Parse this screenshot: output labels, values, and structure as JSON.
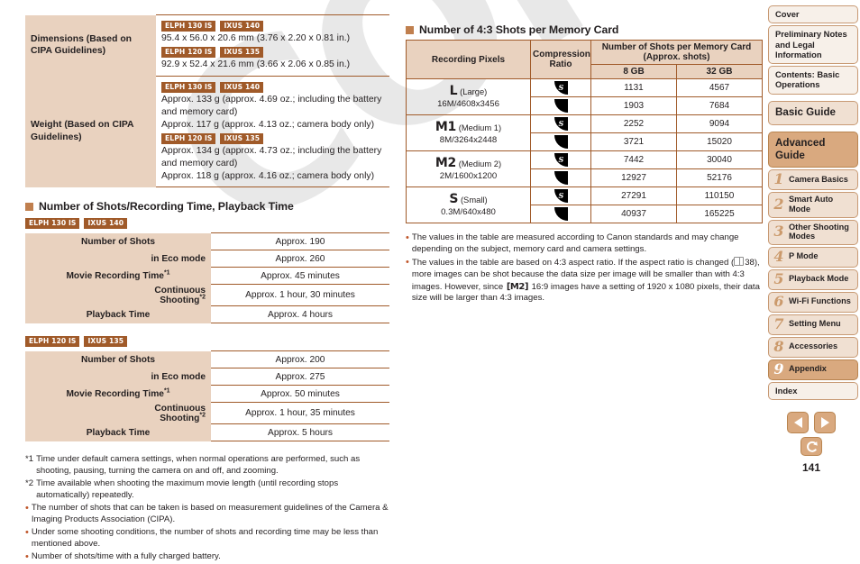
{
  "page": {
    "number": "141"
  },
  "badges": {
    "elph130": "ELPH 130 IS",
    "ixus140": "IXUS 140",
    "elph120": "ELPH 120 IS",
    "ixus135": "IXUS 135"
  },
  "spec_table": {
    "rows": [
      {
        "label": "Dimensions (Based on CIPA Guidelines)",
        "groups": [
          {
            "badges": [
              "ELPH 130 IS",
              "IXUS 140"
            ],
            "lines": [
              "95.4 x 56.0 x 20.6 mm (3.76 x 2.20 x 0.81 in.)"
            ]
          },
          {
            "badges": [
              "ELPH 120 IS",
              "IXUS 135"
            ],
            "lines": [
              "92.9 x 52.4 x 21.6 mm (3.66 x 2.06 x 0.85 in.)"
            ]
          }
        ]
      },
      {
        "label": "Weight (Based on CIPA Guidelines)",
        "groups": [
          {
            "badges": [
              "ELPH 130 IS",
              "IXUS 140"
            ],
            "lines": [
              "Approx. 133 g (approx. 4.69 oz.; including the battery and memory card)",
              "Approx. 117 g (approx. 4.13 oz.; camera body only)"
            ]
          },
          {
            "badges": [
              "ELPH 120 IS",
              "IXUS 135"
            ],
            "lines": [
              "Approx. 134 g (approx. 4.73 oz.; including the battery and memory card)",
              "Approx. 118 g (approx. 4.16 oz.; camera body only)"
            ]
          }
        ]
      }
    ]
  },
  "shots_section": {
    "marker": "square-marker",
    "heading": "Number of Shots/Recording Time, Playback Time",
    "tables": [
      {
        "badges": [
          "ELPH 130 IS",
          "IXUS 140"
        ],
        "rows": [
          {
            "label": "Number of Shots",
            "indent": false,
            "footnote": "",
            "value": "Approx. 190"
          },
          {
            "label": "in Eco mode",
            "indent": true,
            "footnote": "",
            "value": "Approx. 260"
          },
          {
            "label": "Movie Recording Time",
            "indent": false,
            "footnote": "*1",
            "value": "Approx. 45 minutes"
          },
          {
            "label": "Continuous Shooting",
            "indent": true,
            "footnote": "*2",
            "value": "Approx. 1 hour, 30 minutes"
          },
          {
            "label": "Playback Time",
            "indent": false,
            "footnote": "",
            "value": "Approx. 4 hours"
          }
        ]
      },
      {
        "badges": [
          "ELPH 120 IS",
          "IXUS 135"
        ],
        "rows": [
          {
            "label": "Number of Shots",
            "indent": false,
            "footnote": "",
            "value": "Approx. 200"
          },
          {
            "label": "in Eco mode",
            "indent": true,
            "footnote": "",
            "value": "Approx. 275"
          },
          {
            "label": "Movie Recording Time",
            "indent": false,
            "footnote": "*1",
            "value": "Approx. 50 minutes"
          },
          {
            "label": "Continuous Shooting",
            "indent": true,
            "footnote": "*2",
            "value": "Approx. 1 hour, 35 minutes"
          },
          {
            "label": "Playback Time",
            "indent": false,
            "footnote": "",
            "value": "Approx. 5 hours"
          }
        ]
      }
    ]
  },
  "left_notes": [
    {
      "mark": "*1",
      "text": "Time under default camera settings, when normal operations are performed, such as shooting, pausing, turning the camera on and off, and zooming."
    },
    {
      "mark": "*2",
      "text": "Time available when shooting the maximum movie length (until recording stops automatically) repeatedly."
    },
    {
      "mark": "•",
      "text": "The number of shots that can be taken is based on measurement guidelines of the Camera & Imaging Products Association (CIPA)."
    },
    {
      "mark": "•",
      "text": "Under some shooting conditions, the number of shots and recording time may be less than mentioned above."
    },
    {
      "mark": "•",
      "text": "Number of shots/time with a fully charged battery."
    }
  ],
  "memory_section": {
    "heading": "Number of 4:3 Shots per Memory Card",
    "headers": {
      "recording_pixels": "Recording Pixels",
      "compression_ratio": "Compression Ratio",
      "shots_group": "Number of Shots per Memory Card (Approx. shots)",
      "card_8gb": "8 GB",
      "card_32gb": "32 GB"
    },
    "rows": [
      {
        "size": "L",
        "name": "(Large)",
        "dimensions": "16M/4608x3456",
        "entries": [
          {
            "icon": "fine-compression-icon",
            "gb8": "1131",
            "gb32": "4567"
          },
          {
            "icon": "normal-compression-icon",
            "gb8": "1903",
            "gb32": "7684"
          }
        ]
      },
      {
        "size": "M1",
        "name": "(Medium 1)",
        "dimensions": "8M/3264x2448",
        "entries": [
          {
            "icon": "fine-compression-icon",
            "gb8": "2252",
            "gb32": "9094"
          },
          {
            "icon": "normal-compression-icon",
            "gb8": "3721",
            "gb32": "15020"
          }
        ]
      },
      {
        "size": "M2",
        "name": "(Medium 2)",
        "dimensions": "2M/1600x1200",
        "entries": [
          {
            "icon": "fine-compression-icon",
            "gb8": "7442",
            "gb32": "30040"
          },
          {
            "icon": "normal-compression-icon",
            "gb8": "12927",
            "gb32": "52176"
          }
        ]
      },
      {
        "size": "S",
        "name": "(Small)",
        "dimensions": "0.3M/640x480",
        "entries": [
          {
            "icon": "fine-compression-icon",
            "gb8": "27291",
            "gb32": "110150"
          },
          {
            "icon": "normal-compression-icon",
            "gb8": "40937",
            "gb32": "165225"
          }
        ]
      }
    ]
  },
  "right_notes": [
    {
      "parts": [
        {
          "kind": "text",
          "value": "The values in the table are measured according to Canon standards and may change depending on the subject, memory card and camera settings."
        }
      ]
    },
    {
      "parts": [
        {
          "kind": "text",
          "value": "The values in the table are based on 4:3 aspect ratio. If the aspect ratio is changed ("
        },
        {
          "kind": "book-icon",
          "value": ""
        },
        {
          "kind": "text",
          "value": "38), more images can be shot because the data size per image will be smaller than with 4:3 images. However, since "
        },
        {
          "kind": "glyph",
          "value": "[M2]"
        },
        {
          "kind": "text",
          "value": " 16:9 images have a setting of 1920 x 1080 pixels, their data size will be larger than 4:3 images."
        }
      ]
    }
  ],
  "sidebar": {
    "items": [
      {
        "label": "Cover",
        "style": "plain",
        "number": ""
      },
      {
        "label": "Preliminary Notes and Legal Information",
        "style": "plain",
        "number": ""
      },
      {
        "label": "Contents: Basic Operations",
        "style": "plain",
        "number": ""
      },
      {
        "label": "Basic Guide",
        "style": "big",
        "number": ""
      },
      {
        "label": "Advanced Guide",
        "style": "big-active",
        "number": ""
      },
      {
        "label": "Camera Basics",
        "style": "numbered",
        "number": "1"
      },
      {
        "label": "Smart Auto Mode",
        "style": "numbered",
        "number": "2"
      },
      {
        "label": "Other Shooting Modes",
        "style": "numbered",
        "number": "3"
      },
      {
        "label": "P Mode",
        "style": "numbered",
        "number": "4"
      },
      {
        "label": "Playback Mode",
        "style": "numbered",
        "number": "5"
      },
      {
        "label": "Wi-Fi Functions",
        "style": "numbered",
        "number": "6"
      },
      {
        "label": "Setting Menu",
        "style": "numbered",
        "number": "7"
      },
      {
        "label": "Accessories",
        "style": "numbered",
        "number": "8"
      },
      {
        "label": "Appendix",
        "style": "numbered-active",
        "number": "9"
      },
      {
        "label": "Index",
        "style": "plain",
        "number": ""
      }
    ]
  },
  "pagenav": {
    "prev": "previous-page-icon",
    "next": "next-page-icon",
    "back": "back-icon",
    "page_number": "141"
  },
  "watermark": {
    "text": "COPY"
  },
  "colors": {
    "accent_brown": "#a05a29",
    "table_header_bg": "#e9d2bf",
    "sidebar_bg": "#f0e0d2",
    "sidebar_active_bg": "#d9a97f",
    "border": "#a05a29",
    "bullet": "#c0562a"
  }
}
